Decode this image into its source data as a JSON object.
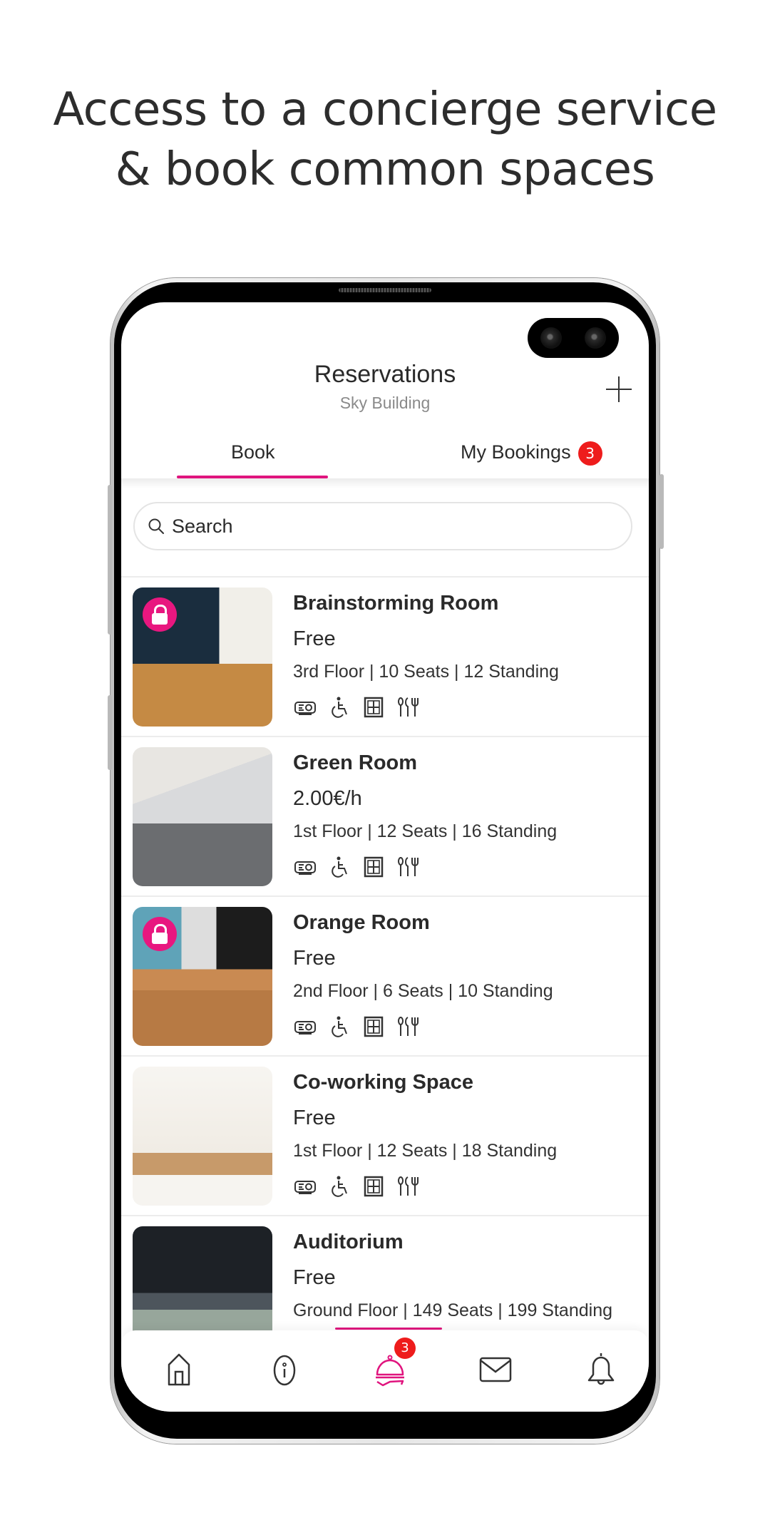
{
  "headline": {
    "line1": "Access to a concierge service",
    "line2": "& book common spaces"
  },
  "header": {
    "title": "Reservations",
    "subtitle": "Sky Building",
    "add_icon": "plus-icon"
  },
  "tabs": [
    {
      "label": "Book",
      "active": true
    },
    {
      "label": "My Bookings",
      "badge": "3",
      "active": false
    }
  ],
  "search": {
    "placeholder": "Search",
    "value": "",
    "icon": "search-icon"
  },
  "rooms": [
    {
      "name": "Brainstorming Room",
      "price": "Free",
      "details": "3rd Floor | 10 Seats | 12 Standing",
      "locked": true,
      "amenities": [
        "projector-icon",
        "wheelchair-accessible-icon",
        "window-icon",
        "catering-icon"
      ]
    },
    {
      "name": "Green Room",
      "price": "2.00€/h",
      "details": "1st Floor | 12 Seats | 16 Standing",
      "locked": false,
      "amenities": [
        "projector-icon",
        "wheelchair-accessible-icon",
        "window-icon",
        "catering-icon"
      ]
    },
    {
      "name": "Orange Room",
      "price": "Free",
      "details": "2nd Floor | 6 Seats | 10 Standing",
      "locked": true,
      "amenities": [
        "projector-icon",
        "wheelchair-accessible-icon",
        "window-icon",
        "catering-icon"
      ]
    },
    {
      "name": "Co-working Space",
      "price": "Free",
      "details": "1st Floor | 12 Seats | 18 Standing",
      "locked": false,
      "amenities": [
        "projector-icon",
        "wheelchair-accessible-icon",
        "window-icon",
        "catering-icon"
      ]
    },
    {
      "name": "Auditorium",
      "price": "Free",
      "details": "Ground Floor | 149 Seats | 199 Standing",
      "locked": false,
      "amenities": []
    }
  ],
  "bottom_nav": [
    {
      "name": "home",
      "icon": "home-icon",
      "active": false
    },
    {
      "name": "info",
      "icon": "info-icon",
      "active": false
    },
    {
      "name": "concierge",
      "icon": "concierge-bell-icon",
      "active": true,
      "badge": "3"
    },
    {
      "name": "messages",
      "icon": "mail-icon",
      "active": false
    },
    {
      "name": "notifications",
      "icon": "bell-icon",
      "active": false
    }
  ],
  "colors": {
    "accent": "#e0147e",
    "badge": "#ee1c1c",
    "text": "#2a2a2a",
    "subtext": "#8a8a8a"
  }
}
